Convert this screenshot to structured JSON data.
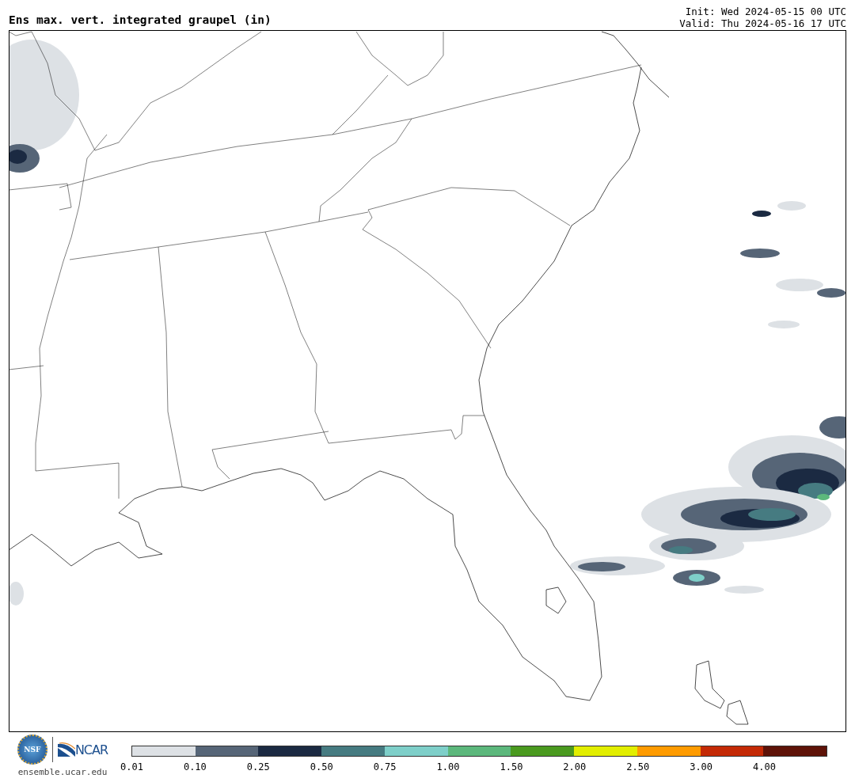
{
  "header": {
    "title": "Ens max. vert. integrated graupel (in)",
    "init": "Init: Wed 2024-05-15 00 UTC",
    "valid": "Valid: Thu 2024-05-16 17 UTC"
  },
  "footer": {
    "nsf_logo_text": "NSF",
    "ncar_logo_text": "NCAR",
    "site": "ensemble.ucar.edu"
  },
  "legend": {
    "bins": [
      {
        "color": "#dde1e5"
      },
      {
        "color": "#566577"
      },
      {
        "color": "#1b2a42"
      },
      {
        "color": "#467b81"
      },
      {
        "color": "#7ecfc9"
      },
      {
        "color": "#5cb87c"
      },
      {
        "color": "#4a9a1f"
      },
      {
        "color": "#e2ee00"
      },
      {
        "color": "#ff9b00"
      },
      {
        "color": "#c42a06"
      },
      {
        "color": "#5e1308"
      }
    ],
    "ticks": [
      "0.01",
      "0.10",
      "0.25",
      "0.50",
      "0.75",
      "1.00",
      "1.50",
      "2.00",
      "2.50",
      "3.00",
      "4.00"
    ]
  }
}
